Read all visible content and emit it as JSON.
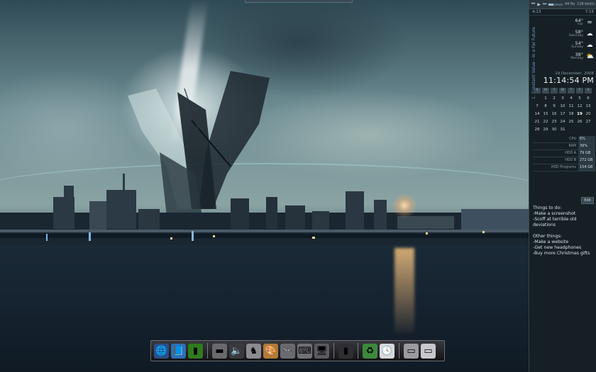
{
  "media": {
    "prev": "⏮",
    "play": "▶",
    "next": "⏭",
    "elapsed": "4:13",
    "remaining": "7:15",
    "bitrate": "128 kbit/s",
    "samplerate": "44 Hz",
    "seek_fraction": 0.35
  },
  "now_playing": "1. Constant Value - In a Far Future",
  "weather": [
    {
      "temp": "64°",
      "day": "Fair",
      "icon": "wind-icon"
    },
    {
      "temp": "58°",
      "day": "Saturday",
      "icon": "cloud-sun-icon"
    },
    {
      "temp": "54°",
      "day": "Sunday",
      "icon": "cloud-icon"
    },
    {
      "temp": "38°",
      "day": "Monday",
      "icon": "cloud-sun-icon"
    }
  ],
  "date": "19 December, 2008",
  "clock": "11:14:54 PM",
  "calendar": {
    "headers": [
      "S",
      "M",
      "T",
      "W",
      "T",
      "F",
      "S"
    ],
    "days": [
      "",
      "1",
      "2",
      "3",
      "4",
      "5",
      "6",
      "7",
      "8",
      "9",
      "10",
      "11",
      "12",
      "13",
      "14",
      "15",
      "16",
      "17",
      "18",
      "19",
      "20",
      "21",
      "22",
      "23",
      "24",
      "25",
      "26",
      "27",
      "28",
      "29",
      "30",
      "31",
      "",
      "",
      ""
    ],
    "today": "19"
  },
  "system": [
    {
      "label": "CPU",
      "value": "6%"
    },
    {
      "label": "RAM",
      "value": "39%"
    },
    {
      "label": "HDD A",
      "value": "79 GB"
    },
    {
      "label": "HDD B",
      "value": "272 GB"
    },
    {
      "label": "HDD Programs",
      "value": "154 GB"
    }
  ],
  "notes": {
    "edit_label": "Edit",
    "todo_title": "Things to do:",
    "todo_items": [
      "-Make a screenshot",
      "-Scoff at terrible old deviations"
    ],
    "other_title": "Other things:",
    "other_items": [
      "-Make a website",
      "-Get new headphones",
      "-Buy more Christmas gifts"
    ]
  },
  "dock": [
    {
      "name": "globe-browser-icon",
      "glyph": "🌐",
      "bg": "#2a4f8a"
    },
    {
      "name": "book-icon",
      "glyph": "📘",
      "bg": "#2d6fb3"
    },
    {
      "name": "audio-visualizer-icon",
      "glyph": "▮",
      "bg": "#2f7b1f"
    },
    {
      "name": "drive-icon",
      "glyph": "▬",
      "bg": "#6a6a6e"
    },
    {
      "name": "speaker-icon",
      "glyph": "🔈",
      "bg": "#3a3a3e"
    },
    {
      "name": "chess-icon",
      "glyph": "♞",
      "bg": "#8a8a90"
    },
    {
      "name": "paint-palette-icon",
      "glyph": "🎨",
      "bg": "#b07a3a"
    },
    {
      "name": "gamepad-icon",
      "glyph": "🎮",
      "bg": "#6a6a70"
    },
    {
      "name": "keyboard-icon",
      "glyph": "⌨",
      "bg": "#707078"
    },
    {
      "name": "computer-icon",
      "glyph": "🖥",
      "bg": "#5a5a60"
    },
    {
      "name": "phone-icon",
      "glyph": "▮",
      "bg": "#2e2e32"
    },
    {
      "name": "recycle-bin-icon",
      "glyph": "♻",
      "bg": "#3c8a3c"
    },
    {
      "name": "clock-icon",
      "glyph": "🕓",
      "bg": "#d8d8dc"
    },
    {
      "name": "display-settings-icon",
      "glyph": "▭",
      "bg": "#9a9aa0"
    },
    {
      "name": "window-switcher-icon",
      "glyph": "▭",
      "bg": "#c8c8cc"
    }
  ]
}
